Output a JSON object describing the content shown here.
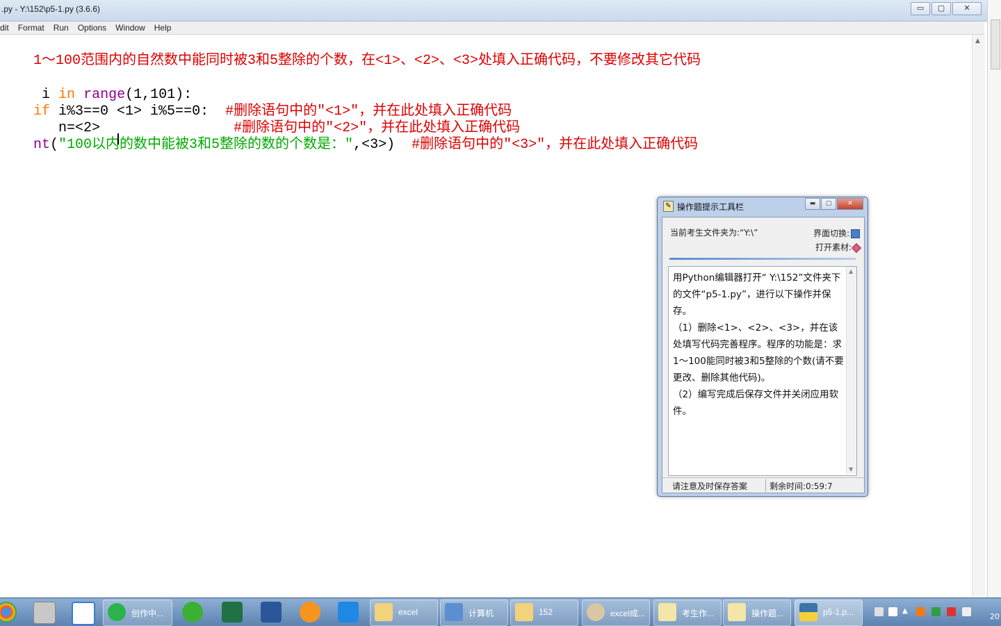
{
  "window": {
    "title": ".py - Y:\\152\\p5-1.py (3.6.6)",
    "buttons": {
      "minimize": "▭",
      "maximize": "▢",
      "close": "✕"
    }
  },
  "menu": [
    "dit",
    "Format",
    "Run",
    "Options",
    "Window",
    "Help"
  ],
  "editor": {
    "line1": "1～100范围内的自然数中能同时被3和5整除的个数，在<1>、<2>、<3>处填入正确代码，不要修改其它代码",
    "line3_indent": " i ",
    "line3_kw": "in",
    "line3_space": " ",
    "line3_fn": "range",
    "line3_rest": "(1,101):",
    "line4_kw": "if",
    "line4_code": " i%3==0 <1> i%5==0:  ",
    "line4_comment": "#删除语句中的\"<1>\"，并在此处填入正确代码",
    "line5_code": "   n=<2>                ",
    "line5_comment": "#删除语句中的\"<2>\"，并在此处填入正确代码",
    "line6_fn": "nt",
    "line6_open": "(",
    "line6_string": "\"100以内的数中能被3和5整除的数的个数是：\"",
    "line6_rest": ",<3>)  ",
    "line6_comment": "#删除语句中的\"<3>\"，并在此处填入正确代码"
  },
  "hint_window": {
    "title": "操作题提示工具栏",
    "folder_label": "当前考生文件夹为:“Y:\\”",
    "switch_label": "界面切换:",
    "open_label": "打开素材:",
    "content": "用Python编辑器打开“ Y:\\152”文件夹下的文件“p5-1.py”，进行以下操作并保存。\n（1）删除<1>、<2>、<3>，并在该处填写代码完善程序。程序的功能是：求1～100能同时被3和5整除的个数(请不要更改、删除其他代码)。\n（2）编写完成后保存文件并关闭应用软件。",
    "status_left": "请注意及时保存答案",
    "status_right": "剩余时间:0:59:7"
  },
  "taskbar": {
    "items": [
      {
        "label": "创作中..."
      },
      {
        "label": "excel"
      },
      {
        "label": "计算机"
      },
      {
        "label": "152"
      },
      {
        "label": "excel成..."
      },
      {
        "label": "考生作..."
      },
      {
        "label": "操作题..."
      },
      {
        "label": "p5-1.p..."
      }
    ],
    "clock": "20"
  },
  "colors": {
    "keyword": "#ff7700",
    "builtin": "#900090",
    "comment": "#dd0000",
    "string": "#00aa00"
  }
}
